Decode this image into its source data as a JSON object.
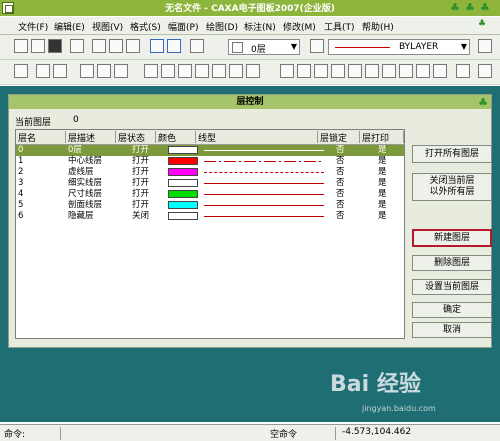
{
  "window": {
    "title": "无名文件 - CAXA电子图板2007(企业版)"
  },
  "menubar": {
    "items": [
      "文件(F)",
      "编辑(E)",
      "视图(V)",
      "格式(S)",
      "幅面(P)",
      "绘图(D)",
      "标注(N)",
      "修改(M)",
      "工具(T)",
      "帮助(H)"
    ]
  },
  "toolbar": {
    "layer_combo": "0层",
    "linetype_combo": "BYLAYER"
  },
  "dialog": {
    "title": "层控制",
    "current_layer_label": "当前图层",
    "current_layer_value": "0",
    "columns": [
      "层名",
      "层描述",
      "层状态",
      "颜色",
      "线型",
      "层锁定",
      "层打印"
    ],
    "layers": [
      {
        "name": "0",
        "desc": "0层",
        "state": "打开",
        "color": "#ffffff",
        "linetype": "solid",
        "lock": "否",
        "print": "是"
      },
      {
        "name": "1",
        "desc": "中心线层",
        "state": "打开",
        "color": "#ff0000",
        "linetype": "dashdot",
        "lock": "否",
        "print": "是"
      },
      {
        "name": "2",
        "desc": "虚线层",
        "state": "打开",
        "color": "#ff00ff",
        "linetype": "dashed",
        "lock": "否",
        "print": "是"
      },
      {
        "name": "3",
        "desc": "细实线层",
        "state": "打开",
        "color": "#ffffff",
        "linetype": "solid",
        "lock": "否",
        "print": "是"
      },
      {
        "name": "4",
        "desc": "尺寸线层",
        "state": "打开",
        "color": "#00dd00",
        "linetype": "solid",
        "lock": "否",
        "print": "是"
      },
      {
        "name": "5",
        "desc": "剖面线层",
        "state": "打开",
        "color": "#00ffff",
        "linetype": "solid",
        "lock": "否",
        "print": "是"
      },
      {
        "name": "6",
        "desc": "隐藏层",
        "state": "关闭",
        "color": "#ffffff",
        "linetype": "solid",
        "lock": "否",
        "print": "是"
      }
    ],
    "buttons": {
      "open_all": "打开所有图层",
      "close_except_line1": "关闭当前层",
      "close_except_line2": "以外所有层",
      "new_layer": "新建图层",
      "delete_layer": "删除图层",
      "set_current": "设置当前图层",
      "ok": "确定",
      "cancel": "取消"
    }
  },
  "statusbar": {
    "cmd_label": "命令:",
    "empty_cmd": "空命令",
    "coords": "-4.573,104.462"
  },
  "watermark": {
    "text": "Bai 经验",
    "url": "jingyan.baidu.com"
  }
}
